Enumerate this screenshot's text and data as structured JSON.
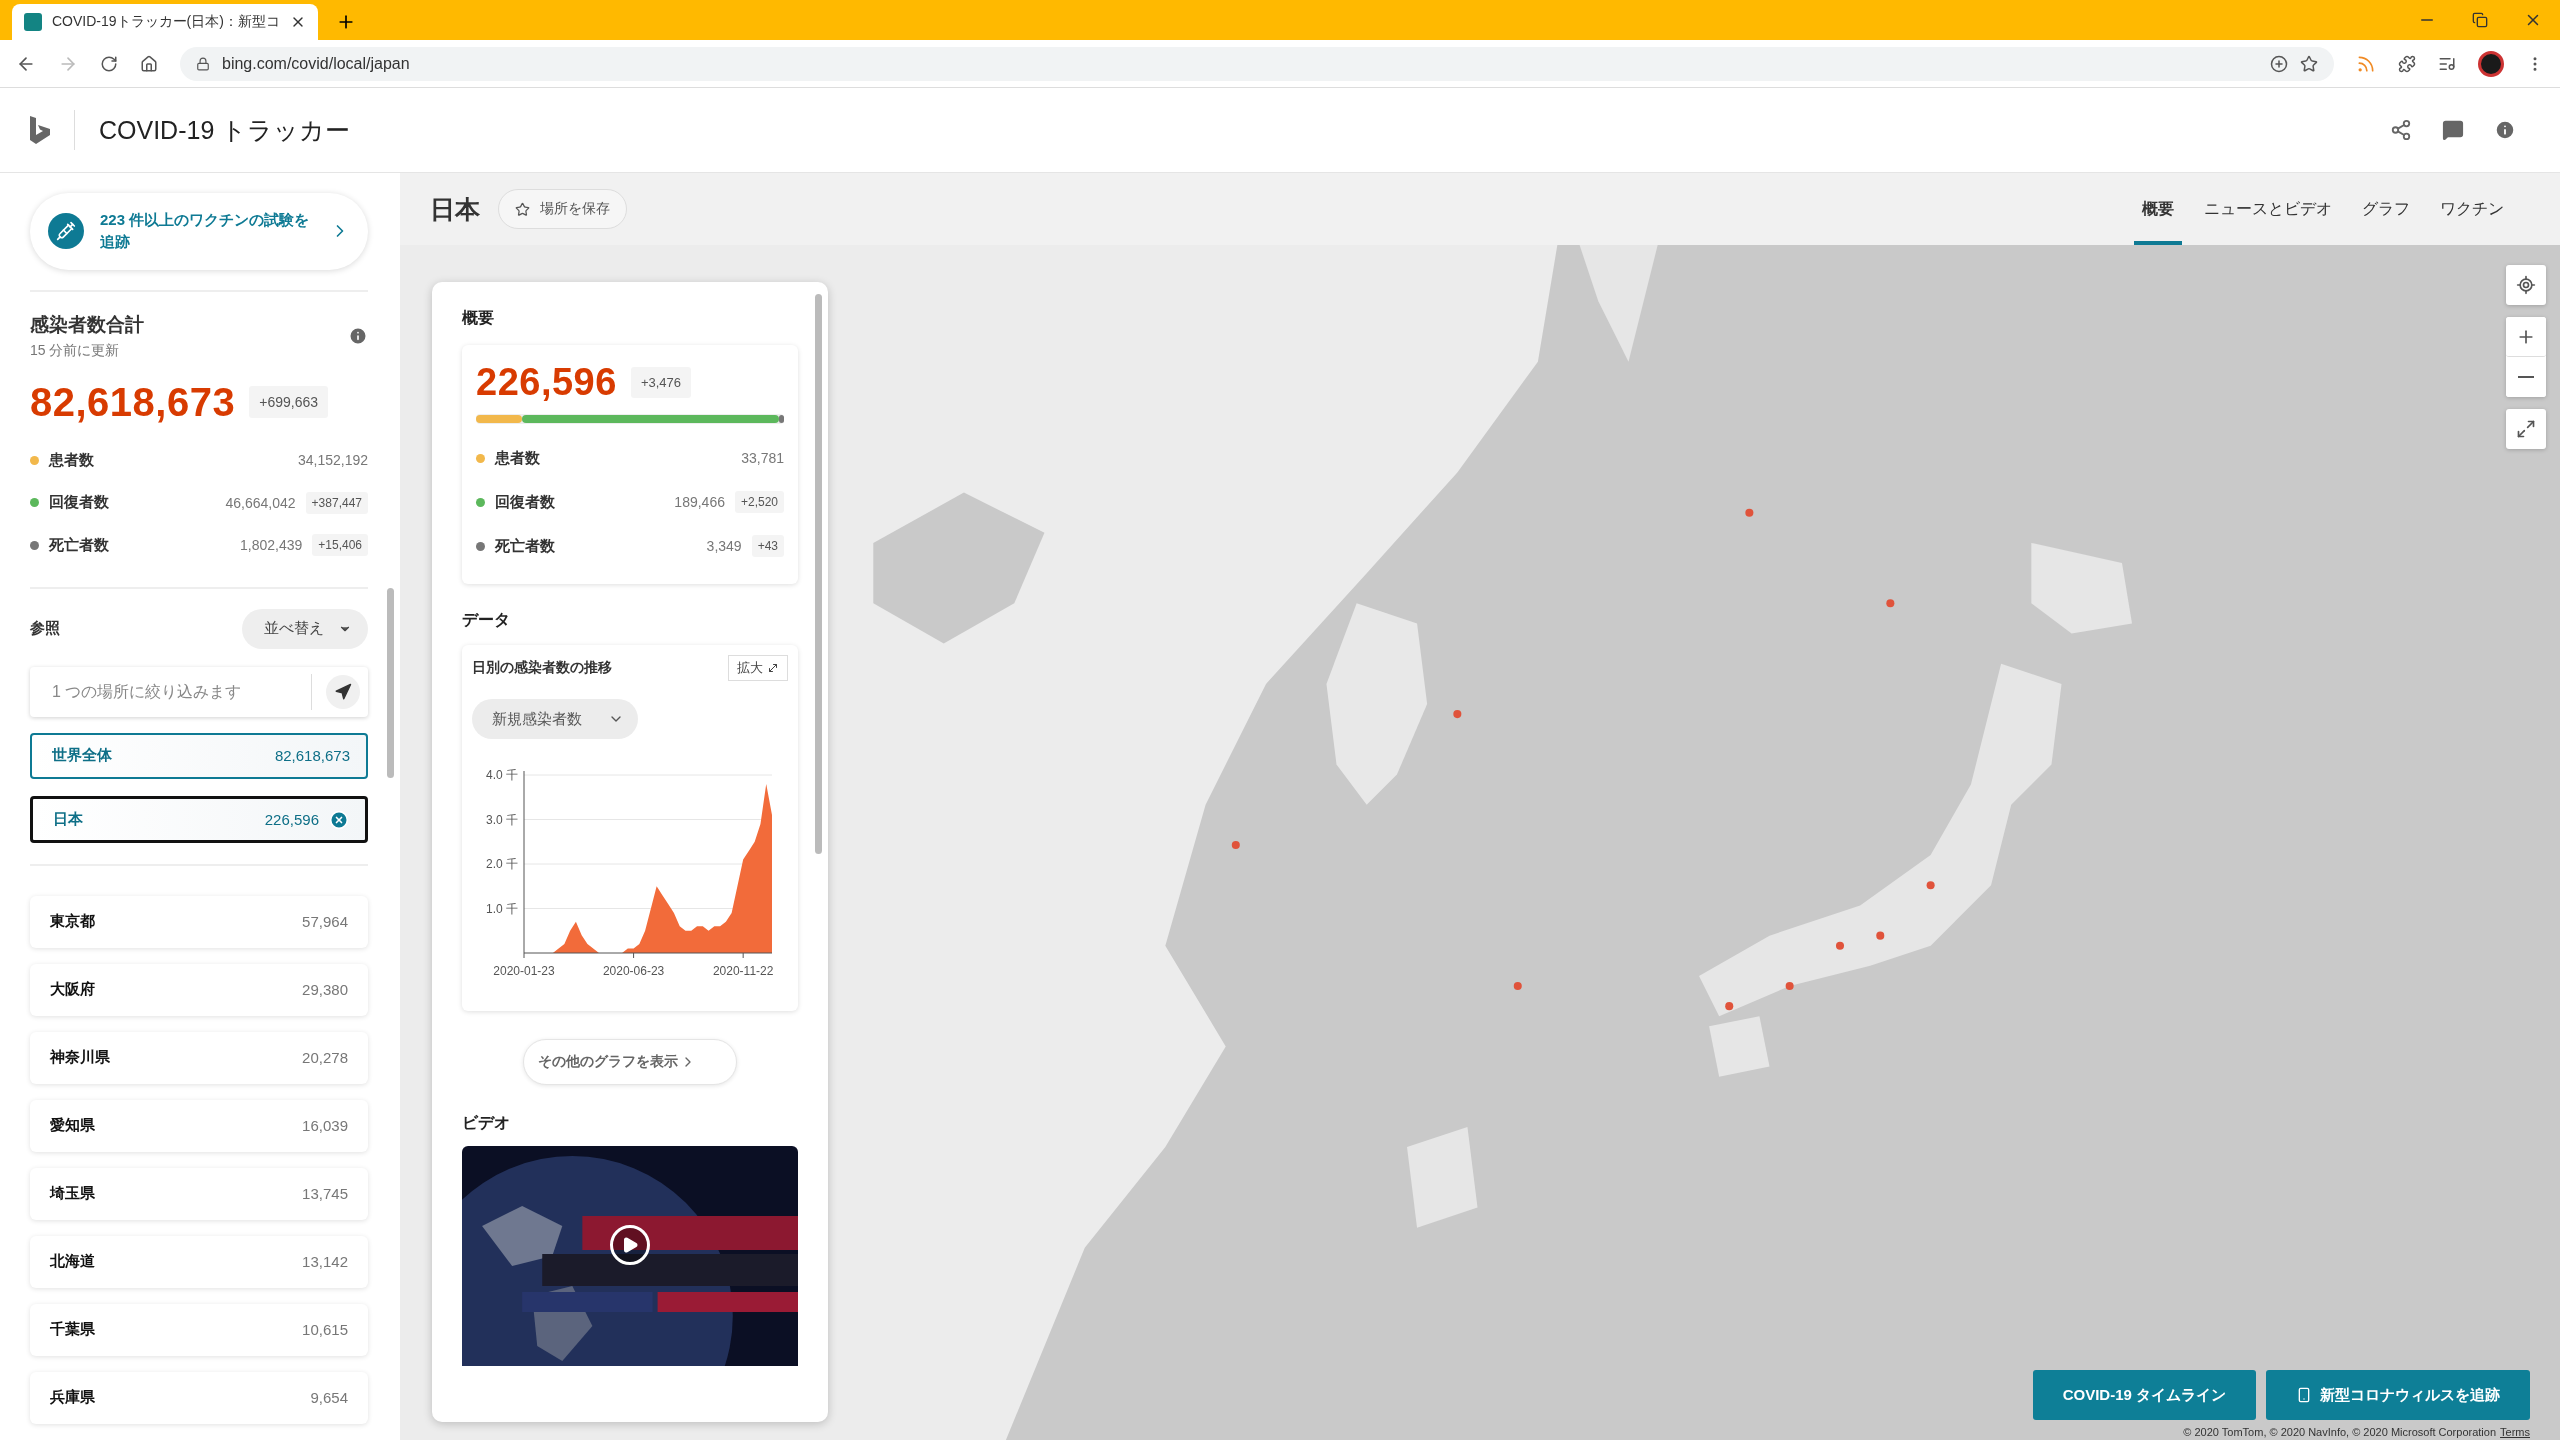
{
  "browser": {
    "tab_title": "COVID-19トラッカー(日本)：新型コ",
    "address": "bing.com/covid/local/japan"
  },
  "app": {
    "title": "COVID-19 トラッカー"
  },
  "sidebar": {
    "promo": "223 件以上のワクチンの試験を追跡",
    "totals": {
      "heading": "感染者数合計",
      "updated": "15 分前に更新",
      "total": "82,618,673",
      "delta": "+699,663",
      "stats": [
        {
          "label": "患者数",
          "value": "34,152,192",
          "color": "#f2b84b"
        },
        {
          "label": "回復者数",
          "value": "46,664,042",
          "delta": "+387,447",
          "color": "#5cb85c"
        },
        {
          "label": "死亡者数",
          "value": "1,802,439",
          "delta": "+15,406",
          "color": "#777777"
        }
      ]
    },
    "browse": {
      "label": "参照",
      "sort": "並べ替え",
      "search": {
        "placeholder": "1 つの場所に絞り込みます"
      },
      "locations": [
        {
          "kind": "world",
          "name": "世界全体",
          "value": "82,618,673",
          "selected": false
        },
        {
          "kind": "country",
          "name": "日本",
          "value": "226,596",
          "selected": true
        }
      ],
      "regions": [
        {
          "name": "東京都",
          "value": "57,964"
        },
        {
          "name": "大阪府",
          "value": "29,380"
        },
        {
          "name": "神奈川県",
          "value": "20,278"
        },
        {
          "name": "愛知県",
          "value": "16,039"
        },
        {
          "name": "埼玉県",
          "value": "13,745"
        },
        {
          "name": "北海道",
          "value": "13,142"
        },
        {
          "name": "千葉県",
          "value": "10,615"
        },
        {
          "name": "兵庫県",
          "value": "9,654"
        }
      ]
    }
  },
  "region": {
    "title": "日本",
    "save": "場所を保存",
    "tabs": [
      {
        "label": "概要",
        "selected": true
      },
      {
        "label": "ニュースとビデオ",
        "selected": false
      },
      {
        "label": "グラフ",
        "selected": false
      },
      {
        "label": "ワクチン",
        "selected": false
      }
    ]
  },
  "panel": {
    "overview": {
      "heading": "概要",
      "total": "226,596",
      "delta": "+3,476",
      "stats": [
        {
          "label": "患者数",
          "value": "33,781",
          "color": "#f2b84b",
          "level": 0.15
        },
        {
          "label": "回復者数",
          "value": "189,466",
          "delta": "+2,520",
          "color": "#5cb85c",
          "level": 0.835
        },
        {
          "label": "死亡者数",
          "value": "3,349",
          "delta": "+43",
          "color": "#777777",
          "level": 0.015
        }
      ]
    },
    "data": {
      "heading": "データ",
      "card_title": "日別の感染者数の推移",
      "expand": "拡大",
      "metric": "新規感染者数",
      "chart_data": {
        "type": "area",
        "categories": [
          "2020-01-23",
          null,
          null,
          null,
          null,
          null,
          null,
          null,
          null,
          null,
          null,
          null,
          null,
          null,
          null,
          null,
          null,
          null,
          null,
          "2020-06-23",
          null,
          null,
          null,
          null,
          null,
          null,
          null,
          null,
          null,
          null,
          null,
          null,
          null,
          null,
          null,
          null,
          null,
          null,
          "2020-11-22",
          null,
          null,
          null,
          null,
          null
        ],
        "series": [
          {
            "color": "#f26b3a",
            "values": [
              0,
              0,
              0,
              0,
              0,
              0,
              0.1,
              0.2,
              0.5,
              0.7,
              0.4,
              0.2,
              0.1,
              0,
              0,
              0,
              0,
              0,
              0.1,
              0.1,
              0.2,
              0.5,
              1.0,
              1.5,
              1.3,
              1.1,
              0.9,
              0.6,
              0.5,
              0.5,
              0.6,
              0.6,
              0.5,
              0.6,
              0.6,
              0.7,
              0.9,
              1.5,
              2.1,
              2.3,
              2.5,
              2.9,
              3.8,
              3.1
            ]
          }
        ],
        "ylim": [
          0,
          4
        ],
        "grid": true,
        "yticks": [
          {
            "value": 1,
            "label": "1.0 千"
          },
          {
            "value": 2,
            "label": "2.0 千"
          },
          {
            "value": 3,
            "label": "3.0 千"
          },
          {
            "value": 4,
            "label": "4.0 千"
          }
        ]
      },
      "more": "その他のグラフを表示"
    },
    "video": {
      "heading": "ビデオ"
    }
  },
  "map": {
    "buttons": [
      "COVID-19 タイムライン",
      "新型コロナウィルスを追跡"
    ],
    "copyright": "© 2020 TomTom, © 2020 NavInfo, © 2020 Microsoft Corporation",
    "terms": "Terms"
  }
}
